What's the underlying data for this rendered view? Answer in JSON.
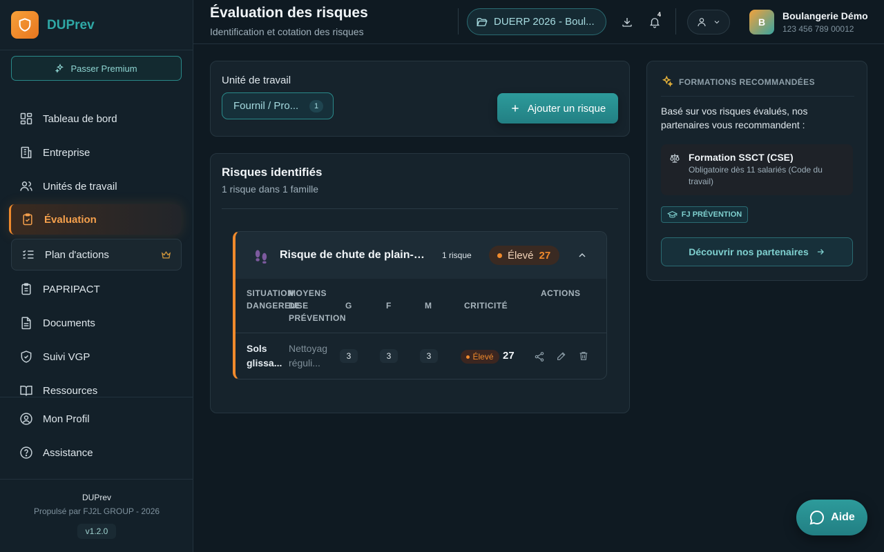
{
  "app": {
    "name": "DUPrev",
    "premium_label": "Passer Premium"
  },
  "sidebar": {
    "items": [
      {
        "label": "Tableau de bord",
        "icon": "dashboard-icon"
      },
      {
        "label": "Entreprise",
        "icon": "building-icon"
      },
      {
        "label": "Unités de travail",
        "icon": "users-icon"
      },
      {
        "label": "Évaluation",
        "icon": "clipboard-check-icon",
        "active": true
      },
      {
        "label": "Plan d'actions",
        "icon": "list-check-icon",
        "premium": true
      },
      {
        "label": "PAPRIPACT",
        "icon": "clipboard-list-icon"
      },
      {
        "label": "Documents",
        "icon": "document-icon"
      },
      {
        "label": "Suivi VGP",
        "icon": "shield-check-icon"
      },
      {
        "label": "Ressources",
        "icon": "book-icon"
      }
    ],
    "bottom_items": [
      {
        "label": "Mon Profil",
        "icon": "user-circle-icon"
      },
      {
        "label": "Assistance",
        "icon": "help-circle-icon"
      }
    ],
    "footer": {
      "brand": "DUPrev",
      "powered": "Propulsé par FJ2L GROUP - 2026",
      "version": "v1.2.0"
    }
  },
  "header": {
    "title": "Évaluation des risques",
    "subtitle": "Identification et cotation des risques",
    "duerp_label": "DUERP 2026 - Boul...",
    "notif_count": "4",
    "company": "Boulangerie Démo",
    "siret": "123 456 789 00012",
    "avatar_letter": "B"
  },
  "unit": {
    "label": "Unité de travail",
    "selected": "Fournil / Pro...",
    "count": "1",
    "add_button": "Ajouter un risque"
  },
  "risks": {
    "title": "Risques identifiés",
    "subtitle": "1 risque dans 1 famille",
    "family": {
      "name": "Risque de chute de plain-pied",
      "count": "1 risque",
      "level": "Élevé",
      "score": "27",
      "columns": {
        "situation_1": "SITUATION",
        "situation_2": "DANGEREUSE",
        "moyens_1": "MOYENS",
        "moyens_2": "DE",
        "moyens_3": "PRÉVENTION",
        "g": "G",
        "f": "F",
        "m": "M",
        "criticite": "CRITICITÉ",
        "actions": "ACTIONS"
      },
      "row": {
        "situation_1": "Sols",
        "situation_2": "glissa...",
        "moyens_1": "Nettoyage",
        "moyens_2": "réguli...",
        "g": "3",
        "f": "3",
        "m": "3",
        "level": "Élevé",
        "score": "27"
      }
    }
  },
  "formations": {
    "heading": "FORMATIONS RECOMMANDÉES",
    "text": "Basé sur vos risques évalués, nos partenaires vous recommandent :",
    "item_title": "Formation SSCT (CSE)",
    "item_desc": "Obligatoire dès 11 salariés (Code du travail)",
    "badge": "FJ PRÉVENTION",
    "discover": "Découvrir nos partenaires"
  },
  "help": {
    "label": "Aide"
  },
  "colors": {
    "accent": "#2fa8a6",
    "warning": "#f08a2c",
    "background": "#0f1a22"
  }
}
